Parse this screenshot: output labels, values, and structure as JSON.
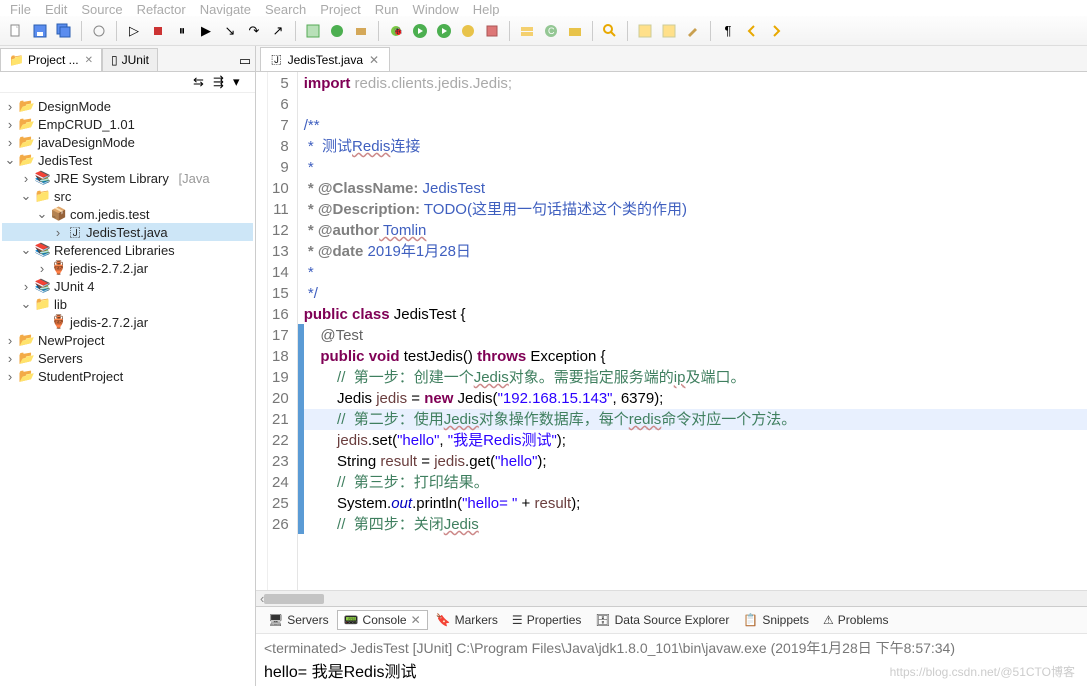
{
  "menu": [
    "File",
    "Edit",
    "Source",
    "Refactor",
    "Navigate",
    "Search",
    "Project",
    "Run",
    "Window",
    "Help"
  ],
  "views": {
    "project_explorer": {
      "label": "Project ..."
    },
    "junit": {
      "label": "JUnit"
    }
  },
  "tree": {
    "design_mode": "DesignMode",
    "emp_crud": "EmpCRUD_1.01",
    "java_design_mode": "javaDesignMode",
    "jedis_test": "JedisTest",
    "jre": "JRE System Library",
    "jre_tag": "[Java",
    "src": "src",
    "pkg": "com.jedis.test",
    "file": "JedisTest.java",
    "ref_libs": "Referenced Libraries",
    "jedis_jar": "jedis-2.7.2.jar",
    "junit4": "JUnit 4",
    "lib": "lib",
    "jedis_jar2": "jedis-2.7.2.jar",
    "new_project": "NewProject",
    "servers": "Servers",
    "student": "StudentProject"
  },
  "editor": {
    "tab": "JedisTest.java",
    "lines": [
      5,
      6,
      7,
      8,
      9,
      10,
      11,
      12,
      13,
      14,
      15,
      16,
      17,
      18,
      19,
      20,
      21,
      22,
      23,
      24,
      25,
      26
    ],
    "code": {
      "l5a": "import",
      "l5b": " redis.clients.jedis.Jedis;",
      "l7": "/**",
      "l8a": " *  测试",
      "l8b": "Redis",
      "l8c": "连接",
      "l9": " *",
      "l10a": " * @ClassName:",
      "l10b": " JedisTest",
      "l11a": " * @Description:",
      "l11b": " TODO",
      "l11c": "(这里用一句话描述这个类的作用)",
      "l12a": " * @author",
      "l12b": " Tomlin",
      "l13a": " * @date",
      "l13b": " 2019年1月28日",
      "l14": " *",
      "l15": " */",
      "l16a": "public",
      "l16b": "class",
      "l16c": "JedisTest {",
      "l17": "@Test",
      "l18a": "public",
      "l18b": "void",
      "l18c": "testJedis()",
      "l18d": "throws",
      "l18e": "Exception {",
      "l19a": "//  第一步：创建一个",
      "l19b": "Jedis",
      "l19c": "对象。需要指定服务端的",
      "l19d": "ip",
      "l19e": "及端口。",
      "l20a": "Jedis ",
      "l20b": "jedis",
      "l20c": " = ",
      "l20d": "new",
      "l20e": " Jedis(",
      "l20f": "\"192.168.15.143\"",
      "l20g": ", 6379);",
      "l21a": "//  第二步：使用",
      "l21b": "Jedis",
      "l21c": "对象操作数据库，每个",
      "l21d": "redis",
      "l21e": "命令对应一个方法。",
      "l22a": "jedis",
      "l22b": ".set(",
      "l22c": "\"hello\"",
      "l22d": ", ",
      "l22e": "\"我是Redis测试\"",
      "l22f": ");",
      "l23a": "String ",
      "l23b": "result",
      "l23c": " = ",
      "l23d": "jedis",
      "l23e": ".get(",
      "l23f": "\"hello\"",
      "l23g": ");",
      "l24": "//  第三步：打印结果。",
      "l25a": "System.",
      "l25b": "out",
      "l25c": ".println(",
      "l25d": "\"hello= \"",
      "l25e": " + ",
      "l25f": "result",
      "l25g": ");",
      "l26a": "//  第四步：关闭",
      "l26b": "Jedis"
    }
  },
  "bottom": {
    "tabs": {
      "servers": "Servers",
      "console": "Console",
      "markers": "Markers",
      "properties": "Properties",
      "dse": "Data Source Explorer",
      "snippets": "Snippets",
      "problems": "Problems"
    },
    "terminated": "<terminated> JedisTest [JUnit] C:\\Program Files\\Java\\jdk1.8.0_101\\bin\\javaw.exe (2019年1月28日 下午8:57:34)",
    "output": "hello= 我是Redis测试"
  },
  "watermark": "https://blog.csdn.net/@51CTO博客"
}
